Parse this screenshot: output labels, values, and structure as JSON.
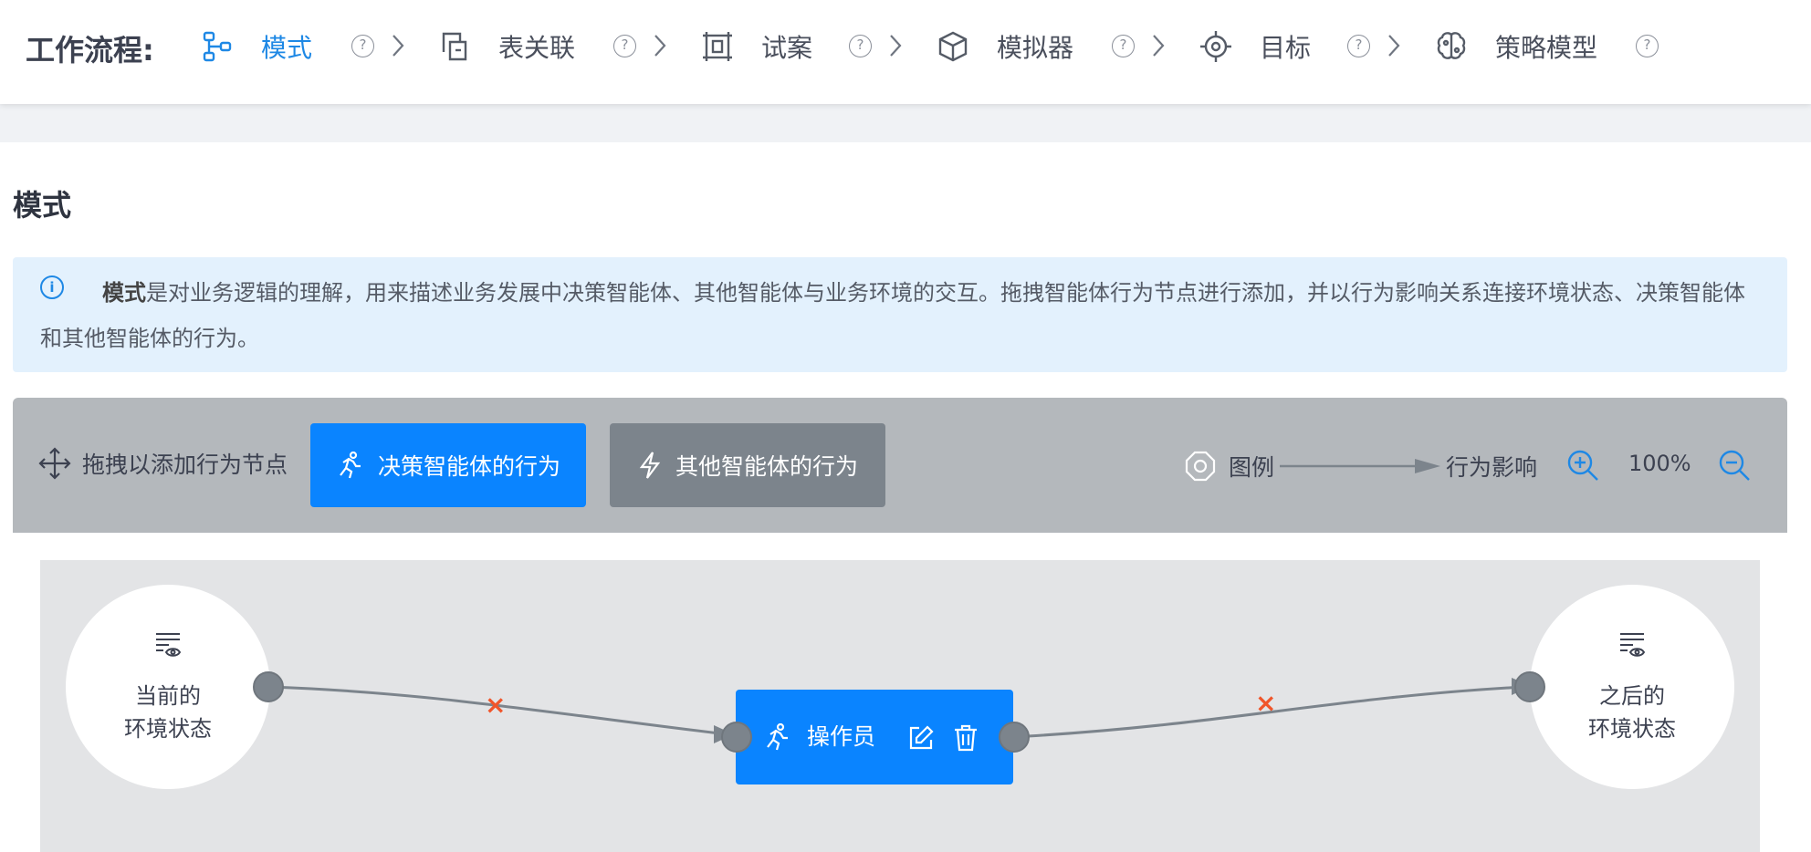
{
  "workflow": {
    "title": "工作流程:",
    "steps": [
      {
        "label": "模式",
        "icon": "schema-icon",
        "active": true
      },
      {
        "label": "表关联",
        "icon": "table-link-icon",
        "active": false
      },
      {
        "label": "试案",
        "icon": "trial-frame-icon",
        "active": false
      },
      {
        "label": "模拟器",
        "icon": "cube-icon",
        "active": false
      },
      {
        "label": "目标",
        "icon": "target-icon",
        "active": false
      },
      {
        "label": "策略模型",
        "icon": "brain-icon",
        "active": false
      }
    ],
    "help_glyph": "?"
  },
  "section": {
    "title": "模式"
  },
  "info": {
    "icon_glyph": "i",
    "bold": "模式",
    "text": "是对业务逻辑的理解，用来描述业务发展中决策智能体、其他智能体与业务环境的交互。拖拽智能体行为节点进行添加，并以行为影响关系连接环境状态、决策智能体和其他智能体的行为。"
  },
  "toolbar": {
    "drag_hint": "拖拽以添加行为节点",
    "primary_button": "决策智能体的行为",
    "secondary_button": "其他智能体的行为",
    "legend_label": "图例",
    "legend_edge_label": "行为影响",
    "zoom": "100%"
  },
  "canvas": {
    "left_node": {
      "line1": "当前的",
      "line2": "环境状态"
    },
    "right_node": {
      "line1": "之后的",
      "line2": "环境状态"
    },
    "action_node": {
      "label": "操作员"
    },
    "edge_delete_glyph": "×"
  },
  "colors": {
    "accent": "#0a84ff",
    "active_step": "#1e88e5",
    "secondary_button": "#7c848c",
    "info_bg": "#e3f1fd",
    "edge_delete": "#f0552a"
  }
}
